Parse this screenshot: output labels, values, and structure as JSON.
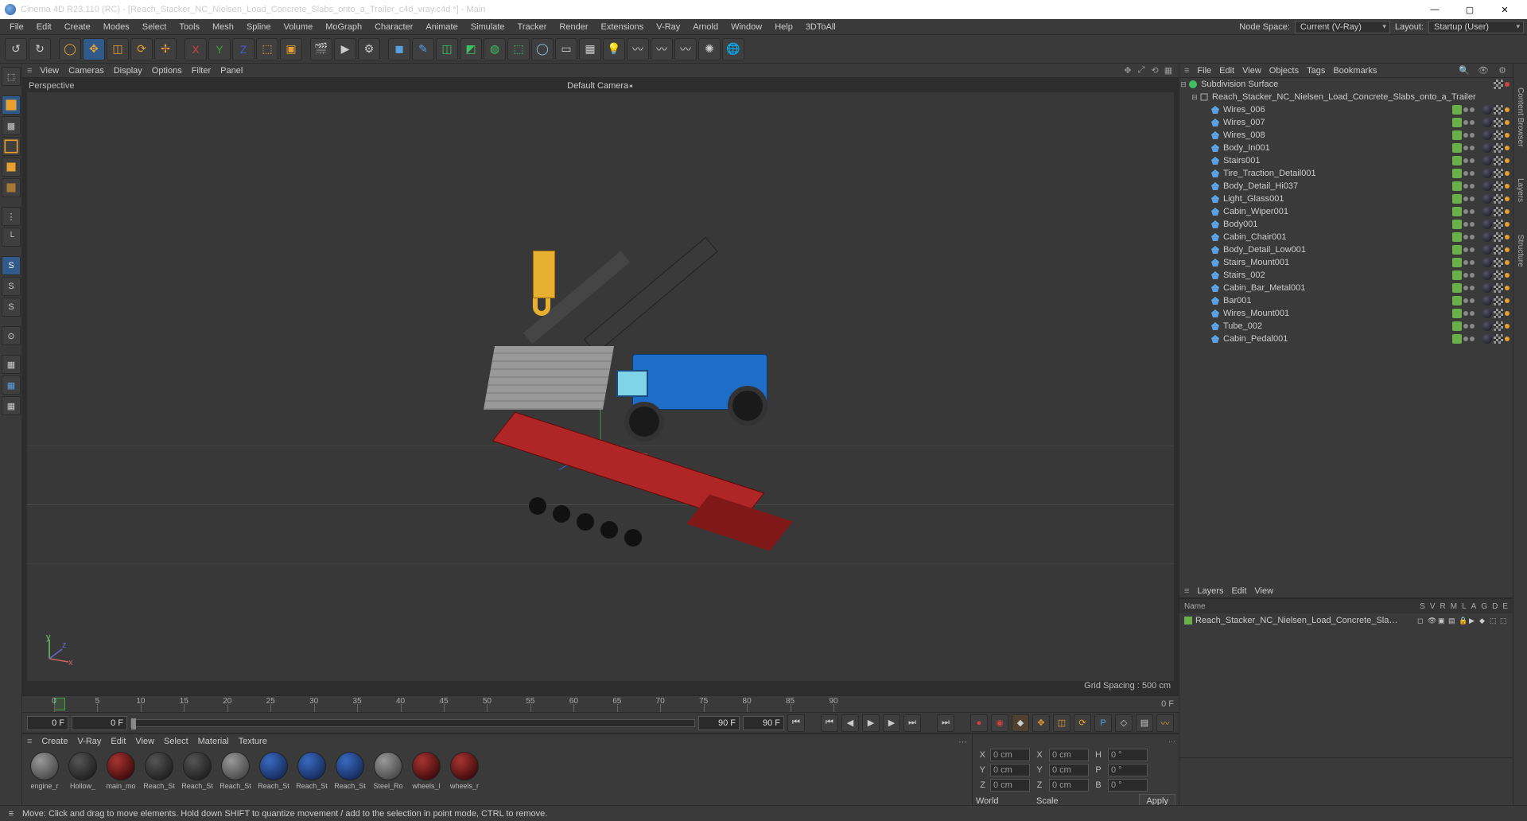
{
  "titlebar": {
    "app": "Cinema 4D R23.110 (RC)",
    "project": "[Reach_Stacker_NC_Nielsen_Load_Concrete_Slabs_onto_a_Trailer_c4d_vray.c4d *]",
    "suffix": "Main"
  },
  "menubar": {
    "items": [
      "File",
      "Edit",
      "Create",
      "Modes",
      "Select",
      "Tools",
      "Mesh",
      "Spline",
      "Volume",
      "MoGraph",
      "Character",
      "Animate",
      "Simulate",
      "Tracker",
      "Render",
      "Extensions",
      "V-Ray",
      "Arnold",
      "Window",
      "Help",
      "3DToAll"
    ],
    "node_space_label": "Node Space:",
    "node_space_value": "Current (V-Ray)",
    "layout_label": "Layout:",
    "layout_value": "Startup (User)"
  },
  "viewport": {
    "menus": [
      "View",
      "Cameras",
      "Display",
      "Options",
      "Filter",
      "Panel"
    ],
    "label_left": "Perspective",
    "label_center": "Default Camera",
    "grid_spacing": "Grid Spacing : 500 cm"
  },
  "timeline": {
    "ticks": [
      "0",
      "5",
      "10",
      "15",
      "20",
      "25",
      "30",
      "35",
      "40",
      "45",
      "50",
      "55",
      "60",
      "65",
      "70",
      "75",
      "80",
      "85",
      "90"
    ],
    "range_end_label": "0 F",
    "frame_start": "0 F",
    "slider_start": "0 F",
    "frame_current": "90 F",
    "frame_end": "90 F"
  },
  "materials": {
    "menus": [
      "Create",
      "V-Ray",
      "Edit",
      "View",
      "Select",
      "Material",
      "Texture"
    ],
    "items": [
      {
        "name": "engine_r",
        "style": "grey"
      },
      {
        "name": "Hollow_",
        "style": "dark"
      },
      {
        "name": "main_mo",
        "style": "red"
      },
      {
        "name": "Reach_St",
        "style": "dark"
      },
      {
        "name": "Reach_St",
        "style": "dark"
      },
      {
        "name": "Reach_St",
        "style": "grey"
      },
      {
        "name": "Reach_St",
        "style": "blue"
      },
      {
        "name": "Reach_St",
        "style": "blue"
      },
      {
        "name": "Reach_St",
        "style": "blue"
      },
      {
        "name": "Steel_Ro",
        "style": "grey"
      },
      {
        "name": "wheels_l",
        "style": "red"
      },
      {
        "name": "wheels_r",
        "style": "red"
      }
    ]
  },
  "coords": {
    "x_label": "X",
    "y_label": "Y",
    "z_label": "Z",
    "x_val": "0 cm",
    "y_val": "0 cm",
    "z_val": "0 cm",
    "sx_val": "0 cm",
    "sy_val": "0 cm",
    "sz_val": "0 cm",
    "h_label": "H",
    "p_label": "P",
    "b_label": "B",
    "h_val": "0 °",
    "p_val": "0 °",
    "b_val": "0 °",
    "world": "World",
    "scale": "Scale",
    "apply": "Apply"
  },
  "objects": {
    "menus": [
      "File",
      "Edit",
      "View",
      "Objects",
      "Tags",
      "Bookmarks"
    ],
    "root": {
      "name": "Subdivision Surface",
      "icon": "subdiv"
    },
    "child": {
      "name": "Reach_Stacker_NC_Nielsen_Load_Concrete_Slabs_onto_a_Trailer",
      "icon": "null"
    },
    "items": [
      "Wires_006",
      "Wires_007",
      "Wires_008",
      "Body_In001",
      "Stairs001",
      "Tire_Traction_Detail001",
      "Body_Detail_Hi037",
      "Light_Glass001",
      "Cabin_Wiper001",
      "Body001",
      "Cabin_Chair001",
      "Body_Detail_Low001",
      "Stairs_Mount001",
      "Stairs_002",
      "Cabin_Bar_Metal001",
      "Bar001",
      "Wires_Mount001",
      "Tube_002",
      "Cabin_Pedal001"
    ]
  },
  "layers": {
    "menus": [
      "Layers",
      "Edit",
      "View"
    ],
    "header_name": "Name",
    "header_flags": [
      "S",
      "V",
      "R",
      "M",
      "L",
      "A",
      "G",
      "D",
      "E"
    ],
    "items": [
      {
        "name": "Reach_Stacker_NC_Nielsen_Load_Concrete_Slabs_onto_a_Trailer"
      }
    ]
  },
  "right_tabs": [
    "Content Browser",
    "Layers",
    "Structure"
  ],
  "statusbar": {
    "text": "Move: Click and drag to move elements. Hold down SHIFT to quantize movement / add to the selection in point mode, CTRL to remove."
  }
}
